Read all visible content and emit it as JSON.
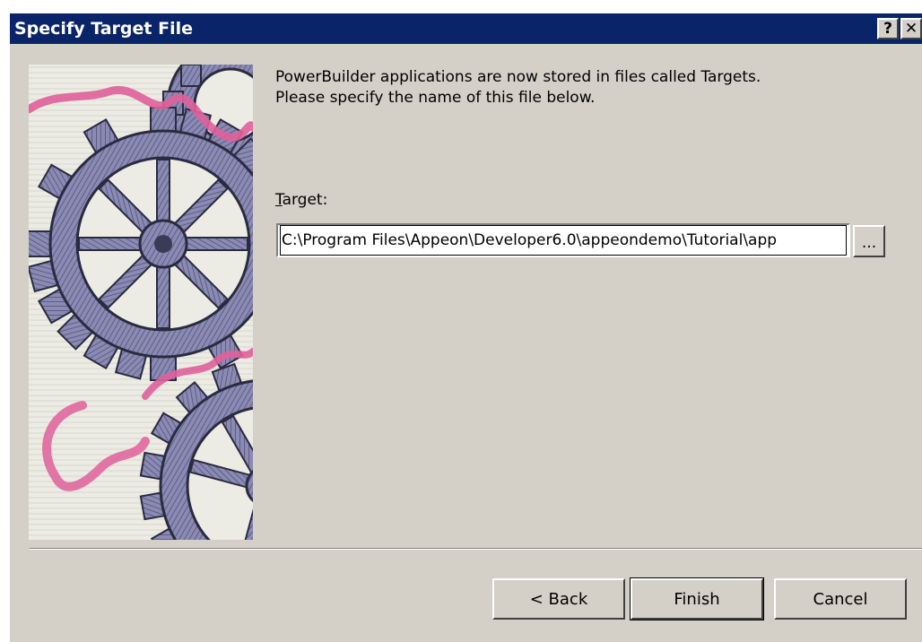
{
  "window": {
    "title": "Specify Target File",
    "help_glyph": "?",
    "close_glyph": "✕"
  },
  "intro": {
    "line1": "PowerBuilder applications are now stored in files called Targets.",
    "line2": "Please specify the name of this file below."
  },
  "target": {
    "label_mnemonic": "T",
    "label_rest": "arget:",
    "value": "C:\\Program Files\\Appeon\\Developer6.0\\appeondemo\\Tutorial\\app",
    "browse_label": "..."
  },
  "buttons": {
    "back": "< Back",
    "finish": "Finish",
    "cancel": "Cancel"
  },
  "colors": {
    "titlebar": "#0a246a",
    "face": "#d4d0c8",
    "gear": "#7a7aa6",
    "ribbon": "#e0609a"
  },
  "icons": {
    "illustration": "gears-illustration"
  }
}
